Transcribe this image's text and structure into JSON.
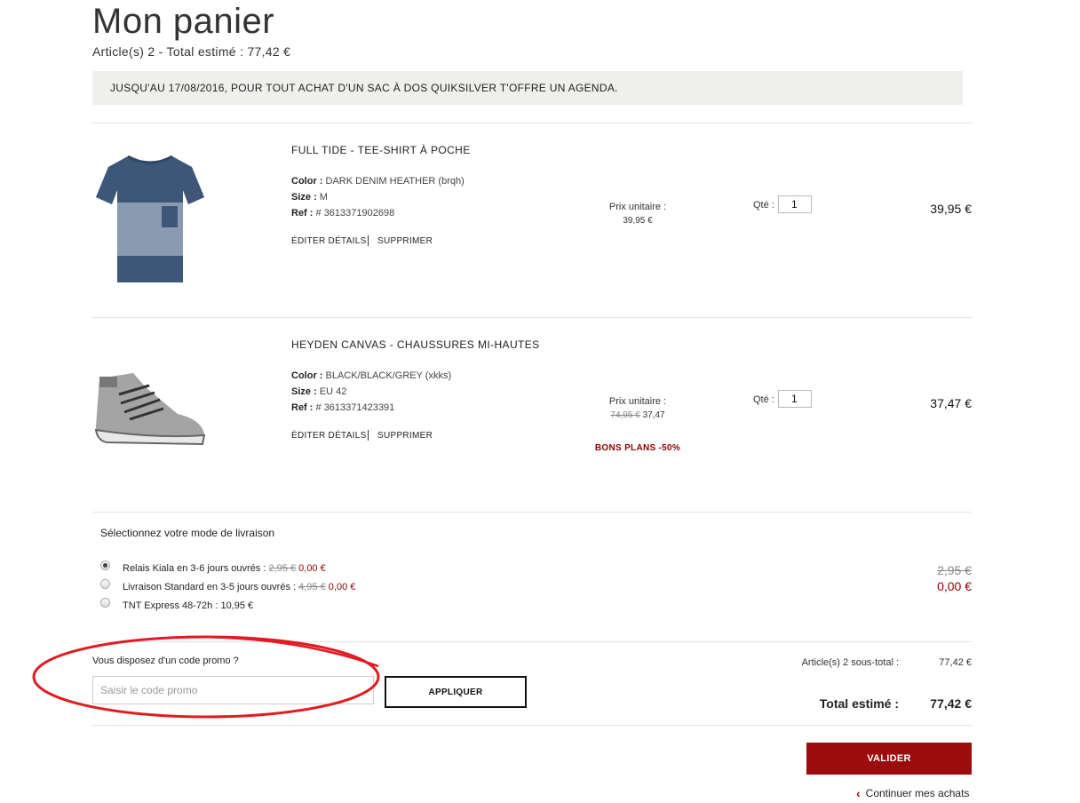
{
  "page": {
    "title": "Mon panier",
    "summary": "Article(s) 2 - Total estimé : 77,42 €",
    "banner": "JUSQU'AU 17/08/2016, POUR TOUT ACHAT D'UN SAC À DOS QUIKSILVER T'OFFRE UN AGENDA."
  },
  "labels": {
    "color": "Color :",
    "size": "Size :",
    "ref": "Ref :",
    "edit": "ÉDITER DÉTAILS",
    "remove": "SUPPRIMER",
    "unit_price": "Prix unitaire :",
    "qty": "Qté :"
  },
  "items": [
    {
      "name": "FULL TIDE - TEE-SHIRT À POCHE",
      "color": "DARK DENIM HEATHER (brqh)",
      "size": "M",
      "ref": "# 3613371902698",
      "unit_price": "39,95 €",
      "qty": "1",
      "total": "39,95 €",
      "image_icon": "tshirt-icon"
    },
    {
      "name": "HEYDEN CANVAS - CHAUSSURES MI-HAUTES",
      "color": "BLACK/BLACK/GREY (xkks)",
      "size": "EU 42",
      "ref": "# 3613371423391",
      "unit_price_old": "74,95 €",
      "unit_price": "37,47",
      "promo_tag": "BONS PLANS -50%",
      "qty": "1",
      "total": "37,47 €",
      "image_icon": "shoe-icon"
    }
  ],
  "shipping": {
    "heading": "Sélectionnez votre mode de livraison",
    "options": [
      {
        "label": "Relais Kiala en 3-6 jours ouvrés :",
        "old": "2,95 €",
        "price": "0,00 €",
        "selected": true
      },
      {
        "label": "Livraison Standard en 3-5 jours ouvrés :",
        "old": "4,95 €",
        "price": "0,00 €",
        "selected": false
      },
      {
        "label": "TNT Express 48-72h : 10,95 €",
        "old": "",
        "price": "",
        "selected": false
      }
    ],
    "total_old": "2,95 €",
    "total": "0,00 €"
  },
  "promo": {
    "question": "Vous disposez d'un code promo ?",
    "placeholder": "Saisir le code promo",
    "apply_label": "APPLIQUER"
  },
  "totals": {
    "subtotal_label": "Article(s) 2 sous-total :",
    "subtotal_value": "77,42 €",
    "total_label": "Total estimé :",
    "total_value": "77,42 €"
  },
  "actions": {
    "validate": "VALIDER",
    "continue": "Continuer mes achats"
  },
  "colors": {
    "accent": "#9c0c0c",
    "annotation_circle": "#e11b22"
  }
}
